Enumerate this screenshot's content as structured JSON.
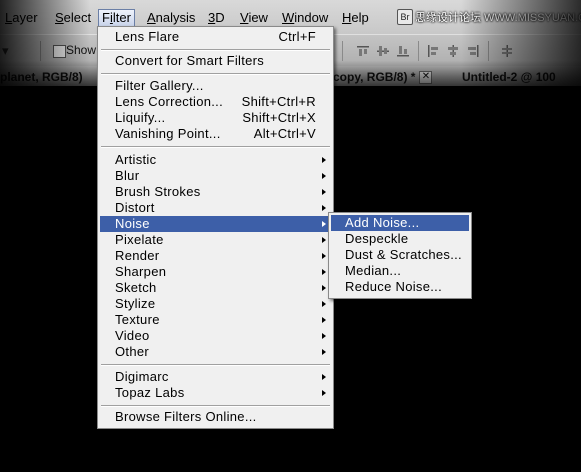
{
  "menubar": {
    "items": [
      {
        "pre": "",
        "mn": "L",
        "post": "ayer"
      },
      {
        "pre": "",
        "mn": "S",
        "post": "elect"
      },
      {
        "pre": "F",
        "mn": "i",
        "post": "lter"
      },
      {
        "pre": "",
        "mn": "A",
        "post": "nalysis"
      },
      {
        "pre": "",
        "mn": "3",
        "post": "D"
      },
      {
        "pre": "",
        "mn": "V",
        "post": "iew"
      },
      {
        "pre": "",
        "mn": "W",
        "post": "indow"
      },
      {
        "pre": "",
        "mn": "H",
        "post": "elp"
      }
    ],
    "badge": "Br",
    "watermark": "思缘设计论坛  WWW.MISSYUAN.COM"
  },
  "options_bar": {
    "show_label": "Show T"
  },
  "tabs": [
    {
      "label": "planet, RGB/8)",
      "close": ""
    },
    {
      "label": "copy, RGB/8) *",
      "close": "✕"
    },
    {
      "label": "Untitled-2 @ 100",
      "close": ""
    }
  ],
  "filter_menu": {
    "items": [
      {
        "label": "Lens Flare",
        "shortcut": "Ctrl+F",
        "submenu": false
      },
      {
        "label": "Convert for Smart Filters",
        "shortcut": "",
        "submenu": false
      },
      {
        "label": "Filter Gallery...",
        "shortcut": "",
        "submenu": false
      },
      {
        "label": "Lens Correction...",
        "shortcut": "Shift+Ctrl+R",
        "submenu": false
      },
      {
        "label": "Liquify...",
        "shortcut": "Shift+Ctrl+X",
        "submenu": false
      },
      {
        "label": "Vanishing Point...",
        "shortcut": "Alt+Ctrl+V",
        "submenu": false
      },
      {
        "label": "Artistic",
        "shortcut": "",
        "submenu": true
      },
      {
        "label": "Blur",
        "shortcut": "",
        "submenu": true
      },
      {
        "label": "Brush Strokes",
        "shortcut": "",
        "submenu": true
      },
      {
        "label": "Distort",
        "shortcut": "",
        "submenu": true
      },
      {
        "label": "Noise",
        "shortcut": "",
        "submenu": true,
        "highlighted": true
      },
      {
        "label": "Pixelate",
        "shortcut": "",
        "submenu": true
      },
      {
        "label": "Render",
        "shortcut": "",
        "submenu": true
      },
      {
        "label": "Sharpen",
        "shortcut": "",
        "submenu": true
      },
      {
        "label": "Sketch",
        "shortcut": "",
        "submenu": true
      },
      {
        "label": "Stylize",
        "shortcut": "",
        "submenu": true
      },
      {
        "label": "Texture",
        "shortcut": "",
        "submenu": true
      },
      {
        "label": "Video",
        "shortcut": "",
        "submenu": true
      },
      {
        "label": "Other",
        "shortcut": "",
        "submenu": true
      },
      {
        "label": "Digimarc",
        "shortcut": "",
        "submenu": true
      },
      {
        "label": "Topaz Labs",
        "shortcut": "",
        "submenu": true
      },
      {
        "label": "Browse Filters Online...",
        "shortcut": "",
        "submenu": false
      }
    ]
  },
  "noise_submenu": {
    "items": [
      {
        "label": "Add Noise...",
        "highlighted": true
      },
      {
        "label": "Despeckle"
      },
      {
        "label": "Dust & Scratches..."
      },
      {
        "label": "Median..."
      },
      {
        "label": "Reduce Noise..."
      }
    ]
  },
  "colors": {
    "highlight": "#3d5fa8",
    "menu_bg": "#f0f0f0",
    "canvas": "#000000"
  }
}
